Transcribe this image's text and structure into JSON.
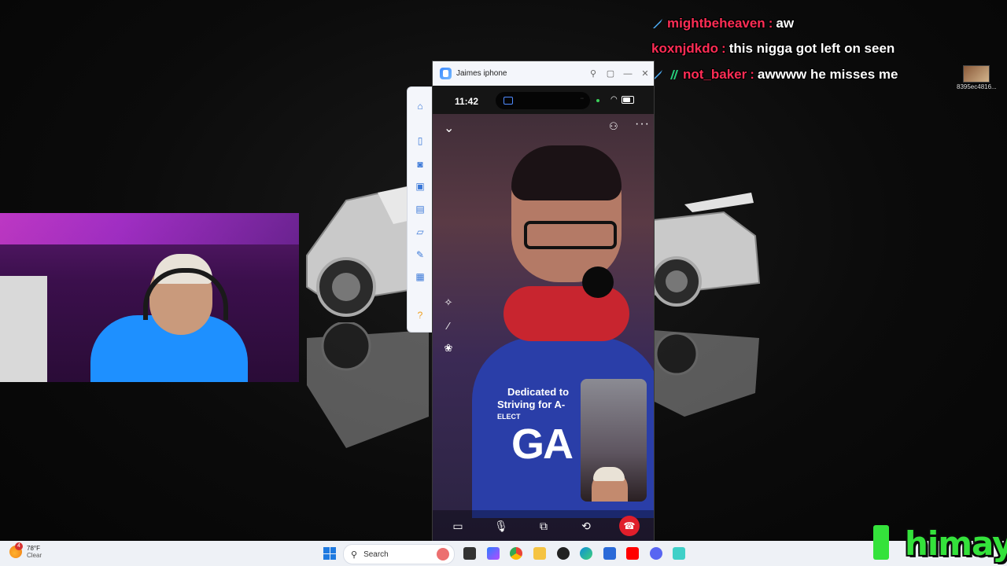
{
  "chat": {
    "messages": [
      {
        "user": "mightbeheaven",
        "text": "aw"
      },
      {
        "user": "koxnjdkdo",
        "text": "this nigga got left on seen"
      },
      {
        "user": "not_baker",
        "text": "awwww he misses me"
      }
    ],
    "corner_caption": "8395ec4816..."
  },
  "phone_window": {
    "title": "Jaimes iphone",
    "buttons": [
      "pin-icon",
      "restore-icon",
      "minimize-icon",
      "close-icon"
    ],
    "time": "11:42",
    "shirt_text": [
      "Dedicated to",
      "Striving for A-",
      "ELECT",
      "GA"
    ],
    "controls": [
      "video-icon",
      "mic-icon",
      "screen-share-icon",
      "flip-camera-icon",
      "end-call-icon"
    ]
  },
  "side_toolbar": {
    "tools": [
      "home-icon",
      "mouse-icon",
      "camera-icon",
      "record-icon",
      "screenshot-icon",
      "file-icon",
      "edit-icon",
      "apps-icon",
      "help-icon"
    ]
  },
  "taskbar": {
    "weather_temp": "78°F",
    "weather_condition": "Clear",
    "notification_count": "4",
    "search_label": "Search"
  },
  "branding": {
    "logo_text": "himay",
    "accent": "#34e23b"
  },
  "colors": {
    "chat_user": "#ff2d55",
    "end_call": "#e01e2b"
  }
}
